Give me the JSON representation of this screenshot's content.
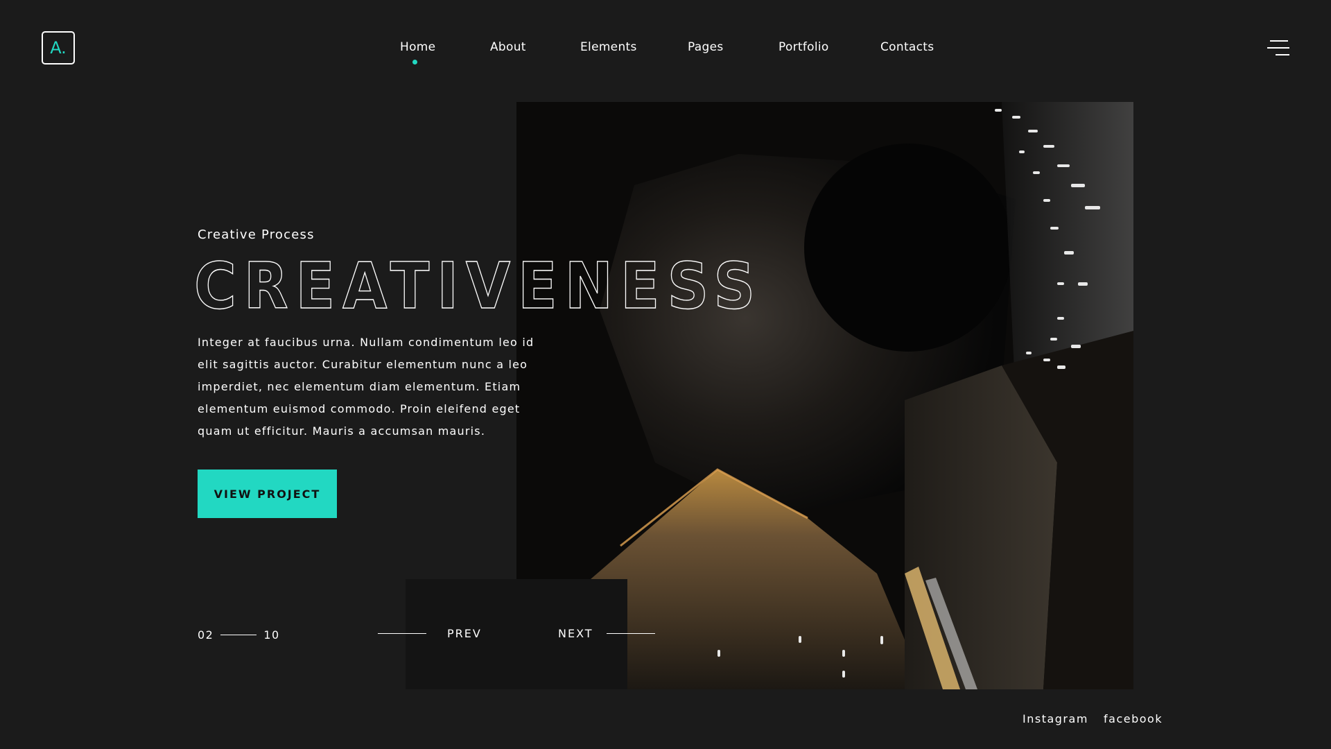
{
  "logo": {
    "text": "A."
  },
  "nav": {
    "items": [
      {
        "label": "Home",
        "active": true
      },
      {
        "label": "About"
      },
      {
        "label": "Elements"
      },
      {
        "label": "Pages"
      },
      {
        "label": "Portfolio"
      },
      {
        "label": "Contacts"
      }
    ]
  },
  "menu": {
    "icon": "hamburger-menu-icon"
  },
  "hero": {
    "eyebrow": "Creative Process",
    "title": "CREATIVENESS",
    "body": "Integer at faucibus urna. Nullam condimentum leo id elit sagittis auctor. Curabitur elementum nunc a leo imperdiet, nec elementum diam elementum. Etiam elementum euismod commodo. Proin eleifend eget quam ut efficitur. Mauris a accumsan mauris.",
    "cta_label": "VIEW PROJECT"
  },
  "slider": {
    "current": "02",
    "total": "10",
    "prev_label": "PREV",
    "next_label": "NEXT"
  },
  "social": {
    "links": [
      {
        "label": "Instagram"
      },
      {
        "label": "facebook"
      }
    ]
  },
  "colors": {
    "background": "#1b1b1b",
    "accent": "#22d8c2",
    "text": "#ffffff",
    "panel": "#141414"
  }
}
